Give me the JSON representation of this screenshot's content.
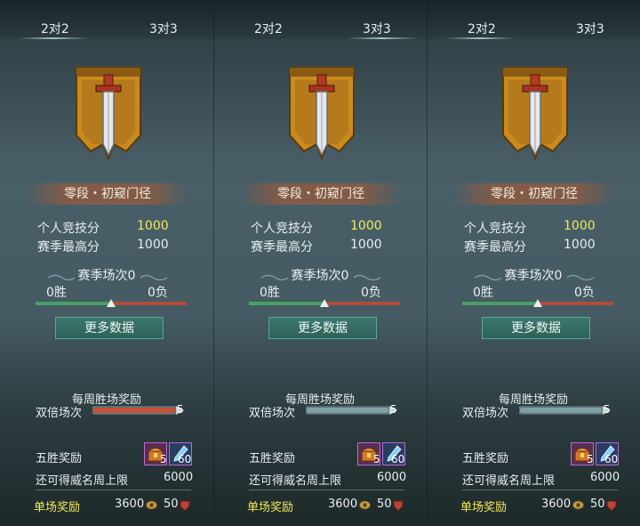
{
  "panels": [
    {
      "tabs": [
        "2对2",
        "3对3"
      ],
      "rank_name": "零段・初窥门径",
      "stats": [
        {
          "label": "个人竞技分",
          "value": "1000"
        },
        {
          "label": "赛季最高分",
          "value": "1000"
        }
      ],
      "season_title": "赛季场次0",
      "wins": "0胜",
      "losses": "0负",
      "more_button": "更多数据",
      "weekly_title": "每周胜场奖励",
      "double_label": "双倍场次",
      "double_count": "5",
      "double_active": true,
      "five_win_label": "五胜奖励",
      "item1_count": "5",
      "item2_count": "60",
      "cap_label": "还可得威名周上限",
      "cap_value": "6000",
      "single_label": "单场奖励",
      "single_coin": "3600",
      "single_honor": "50"
    },
    {
      "tabs": [
        "2对2",
        "3对3"
      ],
      "rank_name": "零段・初窥门径",
      "stats": [
        {
          "label": "个人竞技分",
          "value": "1000"
        },
        {
          "label": "赛季最高分",
          "value": "1000"
        }
      ],
      "season_title": "赛季场次0",
      "wins": "0胜",
      "losses": "0负",
      "more_button": "更多数据",
      "weekly_title": "每周胜场奖励",
      "double_label": "双倍场次",
      "double_count": "5",
      "double_active": false,
      "five_win_label": "五胜奖励",
      "item1_count": "5",
      "item2_count": "60",
      "cap_label": "还可得威名周上限",
      "cap_value": "6000",
      "single_label": "单场奖励",
      "single_coin": "3600",
      "single_honor": "50"
    },
    {
      "tabs": [
        "2对2",
        "3对3"
      ],
      "rank_name": "零段・初窥门径",
      "stats": [
        {
          "label": "个人竞技分",
          "value": "1000"
        },
        {
          "label": "赛季最高分",
          "value": "1000"
        }
      ],
      "season_title": "赛季场次0",
      "wins": "0胜",
      "losses": "0负",
      "more_button": "更多数据",
      "weekly_title": "每周胜场奖励",
      "double_label": "双倍场次",
      "double_count": "5",
      "double_active": false,
      "five_win_label": "五胜奖励",
      "item1_count": "5",
      "item2_count": "60",
      "cap_label": "还可得威名周上限",
      "cap_value": "6000",
      "single_label": "单场奖励",
      "single_coin": "3600",
      "single_honor": "50"
    }
  ],
  "win_ratio_marker": 0.5,
  "colors": {
    "highlight": "#f3e85a",
    "win_bar": "#49a066",
    "loss_bar": "#b34d3b",
    "button": "#2e6258"
  },
  "icons": {
    "emblem": "sword-banner-emblem-icon",
    "chest": "treasure-chest-icon",
    "item2": "blue-talisman-icon",
    "coin": "coin-icon",
    "honor": "honor-shield-icon"
  }
}
